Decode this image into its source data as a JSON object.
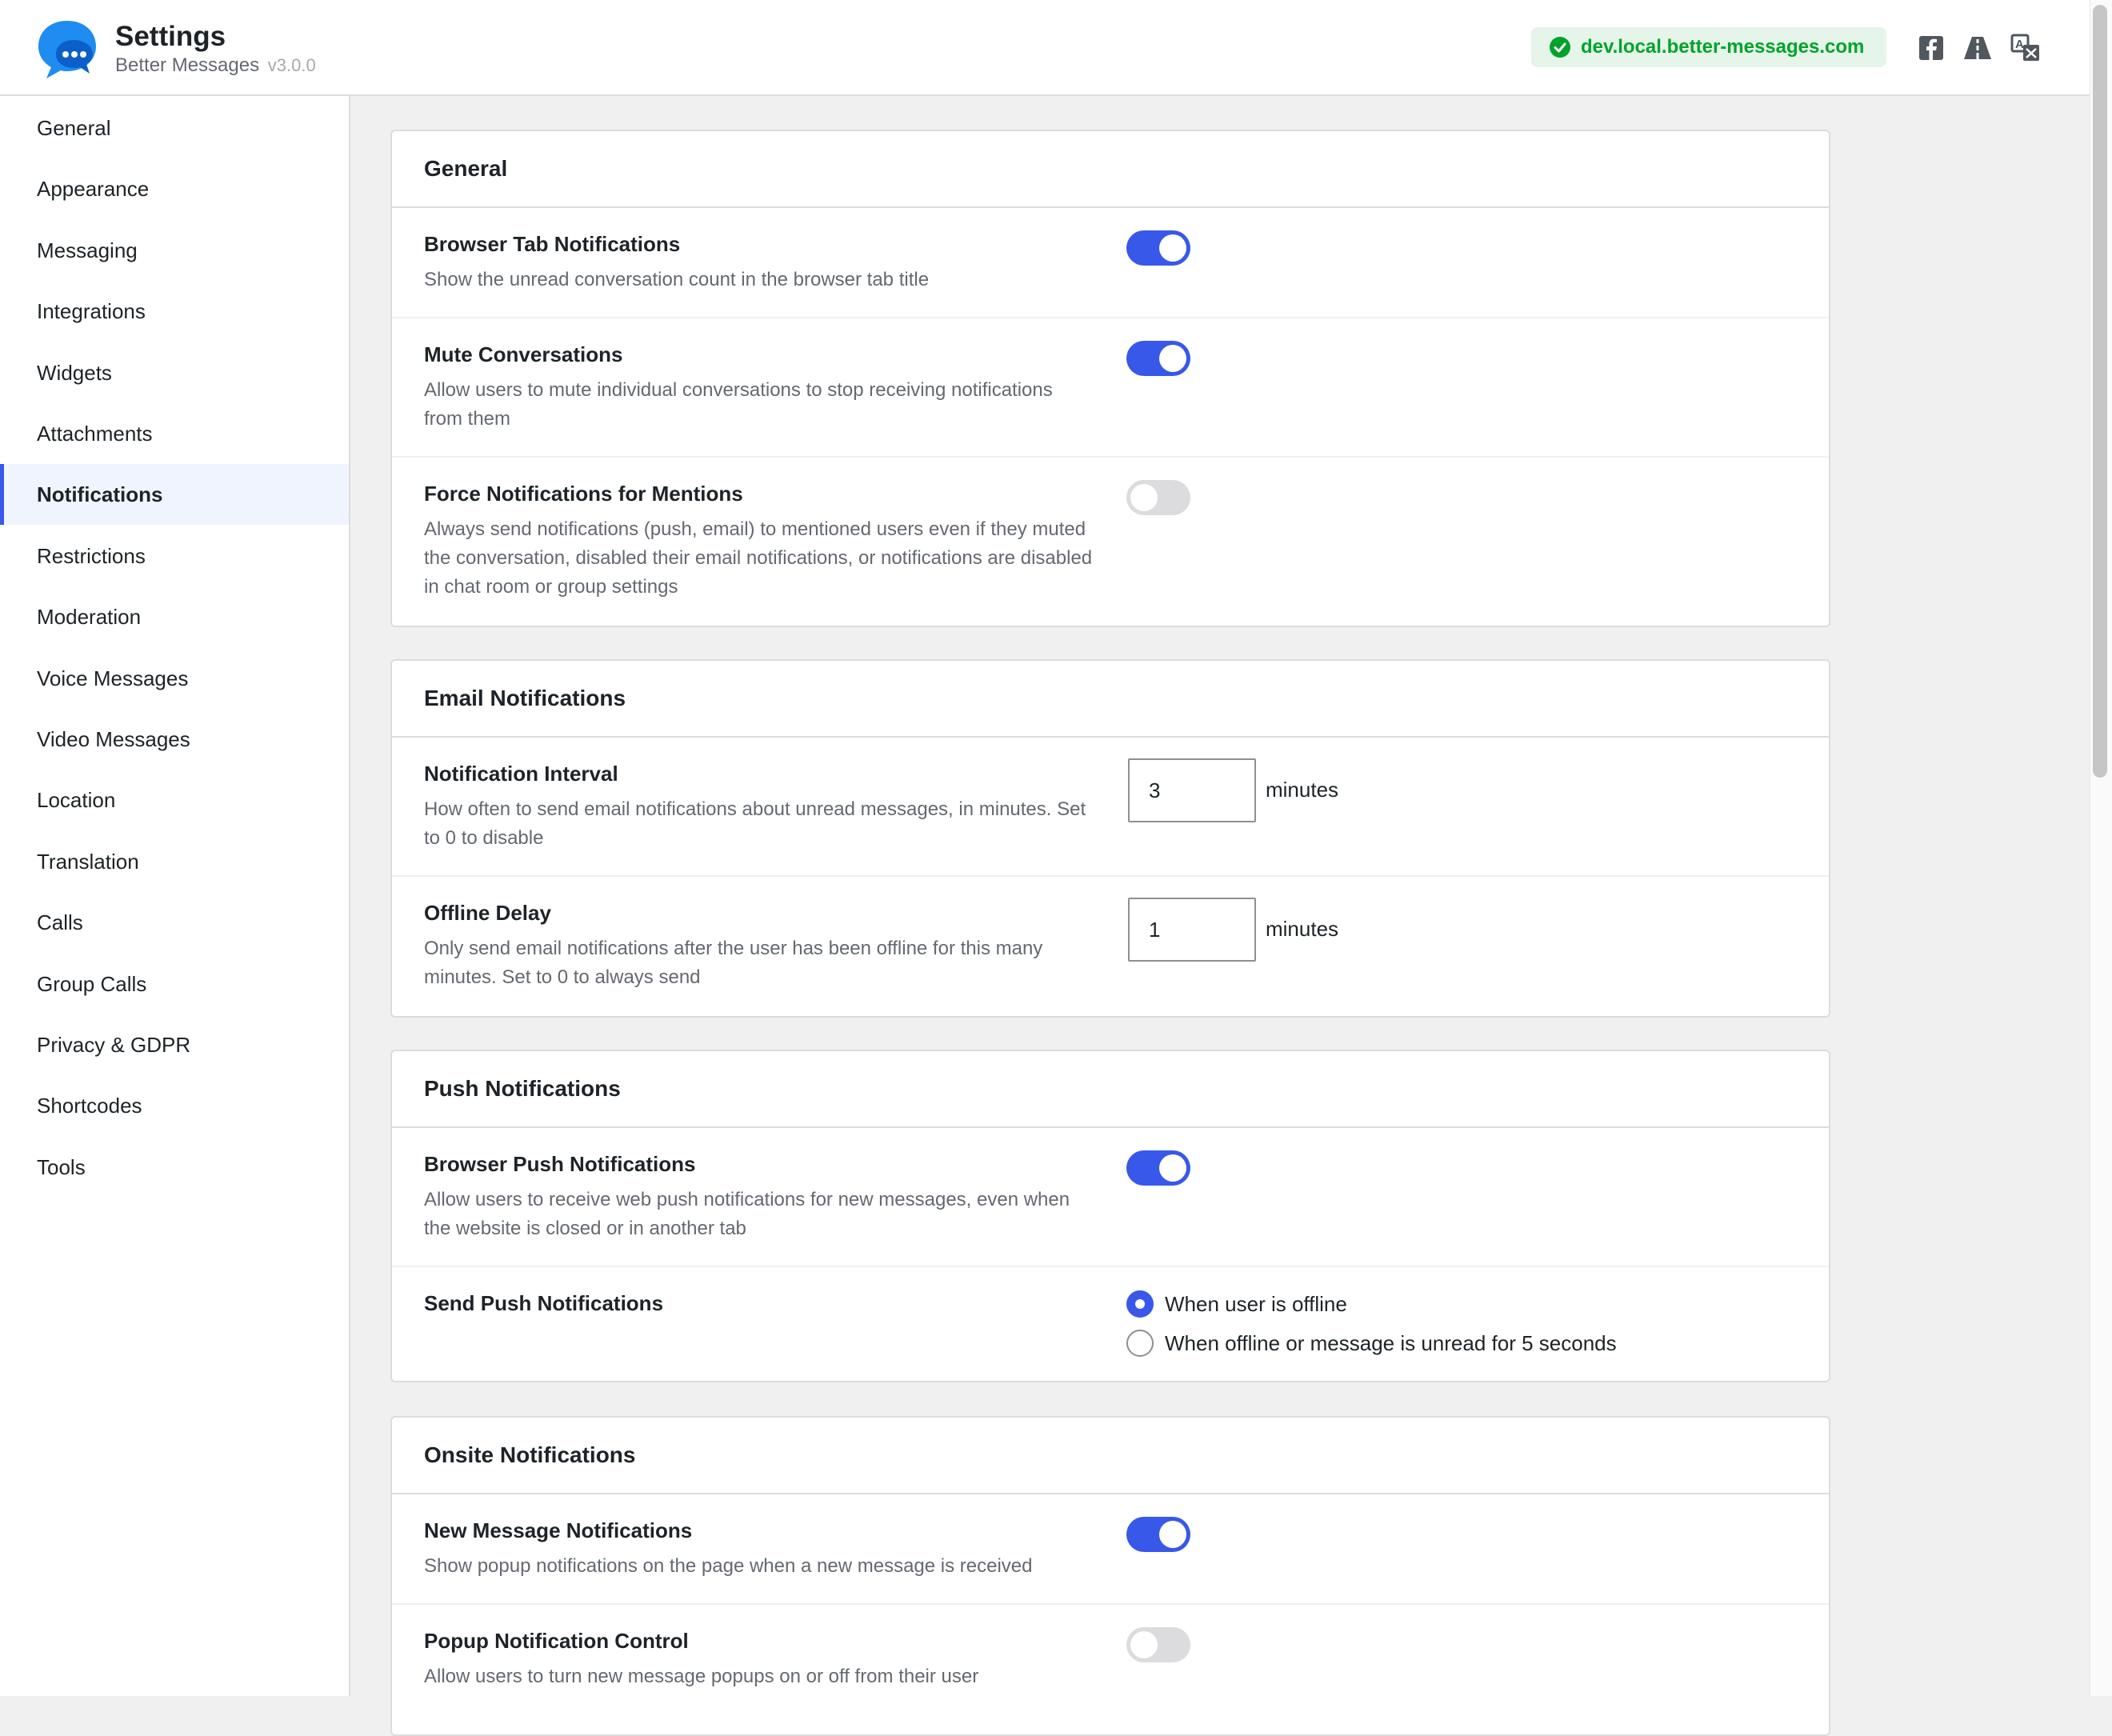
{
  "header": {
    "title": "Settings",
    "subtitle": "Better Messages",
    "version": "v3.0.0",
    "domain": "dev.local.better-messages.com",
    "icons": [
      "check-circle-icon",
      "facebook-icon",
      "road-icon",
      "translate-icon"
    ]
  },
  "sidebar": {
    "items": [
      {
        "label": "General"
      },
      {
        "label": "Appearance"
      },
      {
        "label": "Messaging"
      },
      {
        "label": "Integrations"
      },
      {
        "label": "Widgets"
      },
      {
        "label": "Attachments"
      },
      {
        "label": "Notifications",
        "active": true
      },
      {
        "label": "Restrictions"
      },
      {
        "label": "Moderation"
      },
      {
        "label": "Voice Messages"
      },
      {
        "label": "Video Messages"
      },
      {
        "label": "Location"
      },
      {
        "label": "Translation"
      },
      {
        "label": "Calls"
      },
      {
        "label": "Group Calls"
      },
      {
        "label": "Privacy & GDPR"
      },
      {
        "label": "Shortcodes"
      },
      {
        "label": "Tools"
      }
    ]
  },
  "sections": {
    "general": {
      "title": "General",
      "browser_tab": {
        "title": "Browser Tab Notifications",
        "desc": "Show the unread conversation count in the browser tab title",
        "enabled": true
      },
      "mute": {
        "title": "Mute Conversations",
        "desc": "Allow users to mute individual conversations to stop receiving notifications from them",
        "enabled": true
      },
      "force_mentions": {
        "title": "Force Notifications for Mentions",
        "desc": "Always send notifications (push, email) to mentioned users even if they muted the conversation, disabled their email notifications, or notifications are disabled in chat room or group settings",
        "enabled": false
      }
    },
    "email": {
      "title": "Email Notifications",
      "interval": {
        "title": "Notification Interval",
        "desc": "How often to send email notifications about unread messages, in minutes. Set to 0 to disable",
        "value": "3",
        "unit": "minutes"
      },
      "offline_delay": {
        "title": "Offline Delay",
        "desc": "Only send email notifications after the user has been offline for this many minutes. Set to 0 to always send",
        "value": "1",
        "unit": "minutes"
      }
    },
    "push": {
      "title": "Push Notifications",
      "browser_push": {
        "title": "Browser Push Notifications",
        "desc": "Allow users to receive web push notifications for new messages, even when the website is closed or in another tab",
        "enabled": true
      },
      "send": {
        "title": "Send Push Notifications",
        "options": [
          "When user is offline",
          "When offline or message is unread for 5 seconds"
        ],
        "selected": 0
      }
    },
    "onsite": {
      "title": "Onsite Notifications",
      "new_message": {
        "title": "New Message Notifications",
        "desc": "Show popup notifications on the page when a new message is received",
        "enabled": true
      },
      "popup_control": {
        "title": "Popup Notification Control",
        "desc": "Allow users to turn new message popups on or off from their user",
        "enabled": false
      }
    }
  },
  "colors": {
    "accent": "#3858e9",
    "success": "#00a32a",
    "brand_blue": "#1e8cf1"
  }
}
